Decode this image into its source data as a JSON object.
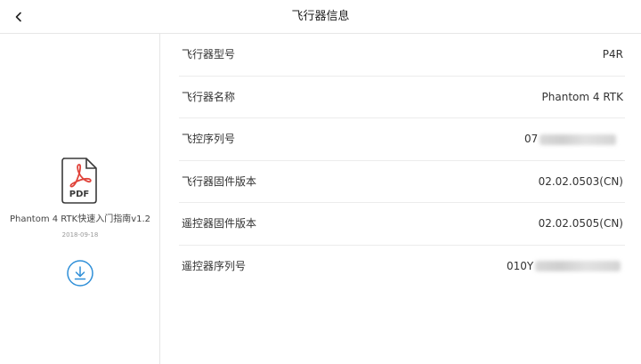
{
  "header": {
    "title": "飞行器信息",
    "back_icon": "chevron-left-icon"
  },
  "sidebar": {
    "document": {
      "icon": "pdf-file-icon",
      "icon_label": "PDF",
      "name": "Phantom 4 RTK快速入门指南v1.2",
      "date": "2018-09-18"
    },
    "download_icon": "download-icon",
    "accent_color": "#2f8fd8",
    "pdf_color": "#e0433a"
  },
  "info": {
    "rows": [
      {
        "label": "飞行器型号",
        "value": "P4R"
      },
      {
        "label": "飞行器名称",
        "value": "Phantom 4 RTK"
      },
      {
        "label": "飞控序列号",
        "value": "07",
        "masked": true
      },
      {
        "label": "飞行器固件版本",
        "value": "02.02.0503(CN)"
      },
      {
        "label": "遥控器固件版本",
        "value": "02.02.0505(CN)"
      },
      {
        "label": "遥控器序列号",
        "value": "010Y",
        "masked": true
      }
    ]
  }
}
